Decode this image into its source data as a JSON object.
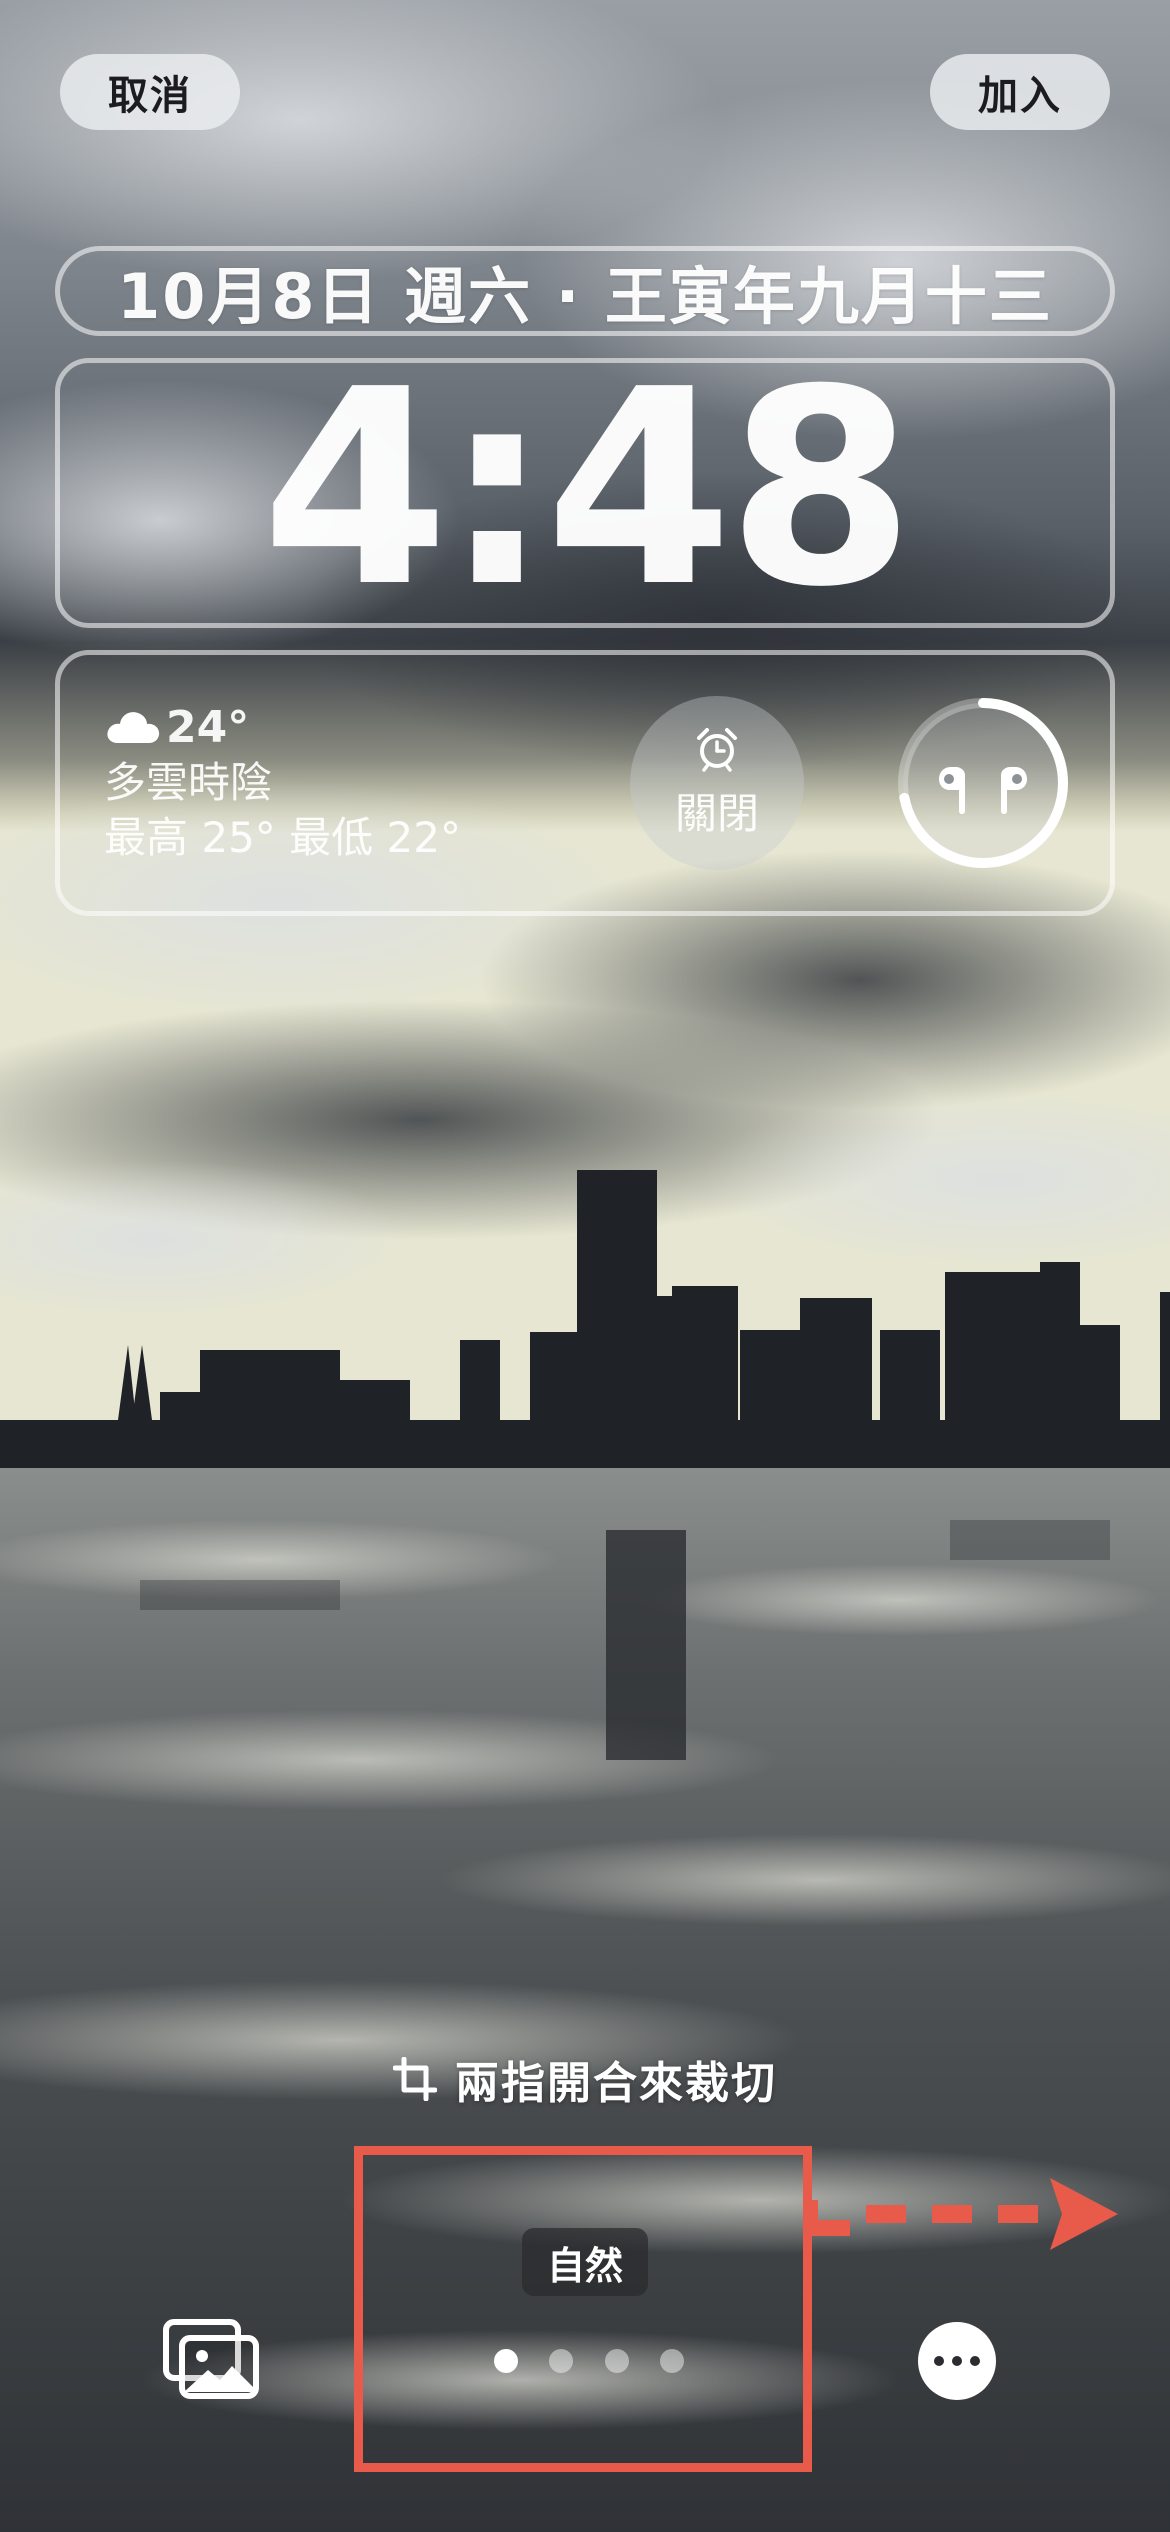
{
  "top_bar": {
    "cancel_label": "取消",
    "add_label": "加入"
  },
  "lock_screen": {
    "date_line": "10月8日 週六 · 王寅年九月十三",
    "time": "4:48",
    "weather": {
      "icon": "cloud-icon",
      "temperature": "24°",
      "condition": "多雲時陰",
      "high_low": "最高 25° 最低 22°"
    },
    "alarm": {
      "icon": "alarm-clock-icon",
      "label": "關閉"
    },
    "airpods": {
      "icon": "airpods-pro-icon",
      "battery_fraction": 0.72
    }
  },
  "editor": {
    "crop_hint": "兩指開合來裁切",
    "filter_name": "自然",
    "page_count": 4,
    "active_page": 0
  },
  "bottom_bar": {
    "photos_icon": "photo-library-icon",
    "more_icon": "ellipsis-icon"
  },
  "colors": {
    "annotation": "#e85a4a",
    "button_bg": "#eceef0",
    "widget_text": "#ffffff"
  }
}
